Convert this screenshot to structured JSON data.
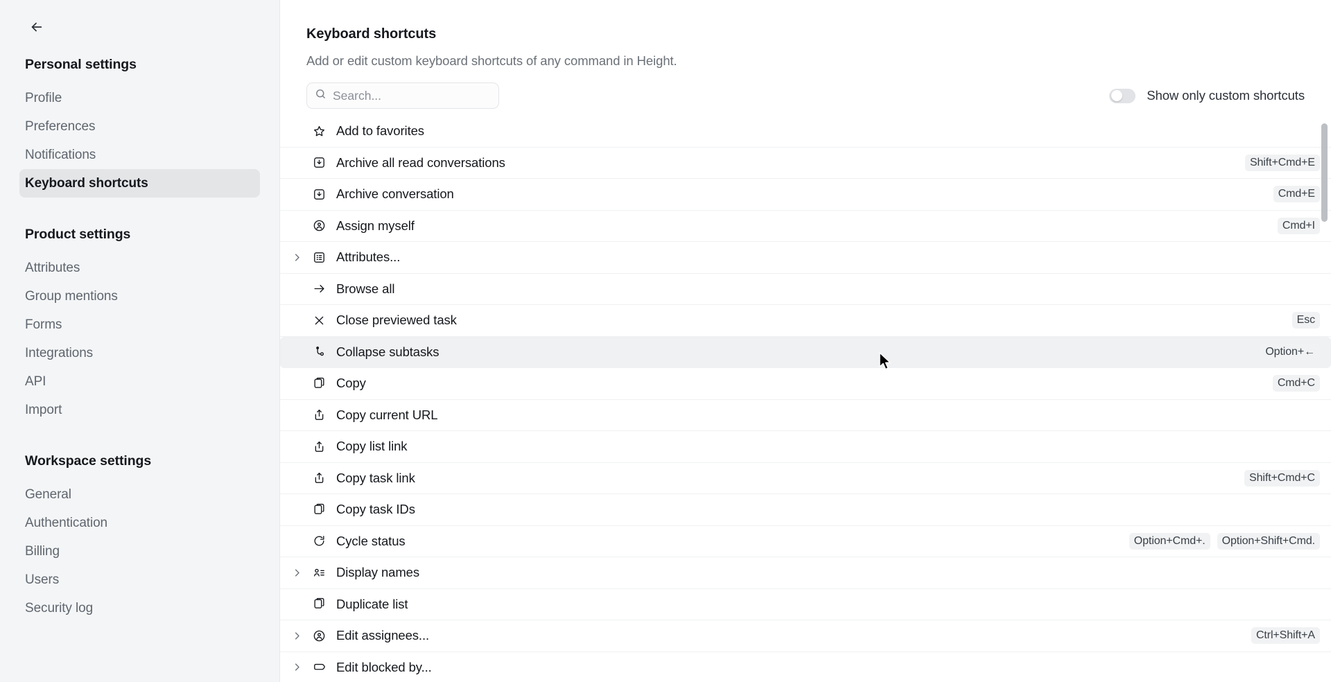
{
  "sidebar": {
    "back_icon": "arrow-left-icon",
    "groups": [
      {
        "title": "Personal settings",
        "items": [
          {
            "label": "Profile",
            "active": false
          },
          {
            "label": "Preferences",
            "active": false
          },
          {
            "label": "Notifications",
            "active": false
          },
          {
            "label": "Keyboard shortcuts",
            "active": true
          }
        ]
      },
      {
        "title": "Product settings",
        "items": [
          {
            "label": "Attributes",
            "active": false
          },
          {
            "label": "Group mentions",
            "active": false
          },
          {
            "label": "Forms",
            "active": false
          },
          {
            "label": "Integrations",
            "active": false
          },
          {
            "label": "API",
            "active": false
          },
          {
            "label": "Import",
            "active": false
          }
        ]
      },
      {
        "title": "Workspace settings",
        "items": [
          {
            "label": "General",
            "active": false
          },
          {
            "label": "Authentication",
            "active": false
          },
          {
            "label": "Billing",
            "active": false
          },
          {
            "label": "Users",
            "active": false
          },
          {
            "label": "Security log",
            "active": false
          }
        ]
      }
    ]
  },
  "main": {
    "title": "Keyboard shortcuts",
    "subtitle": "Add or edit custom keyboard shortcuts of any command in Height.",
    "search": {
      "value": "",
      "placeholder": "Search...",
      "icon": "search-icon"
    },
    "toggle": {
      "label": "Show only custom shortcuts",
      "on": false
    },
    "shortcuts": [
      {
        "label": "Add to favorites",
        "icon": "star-icon",
        "expandable": false,
        "keys": []
      },
      {
        "label": "Archive all read conversations",
        "icon": "archive-icon",
        "expandable": false,
        "keys": [
          "Shift+Cmd+E"
        ]
      },
      {
        "label": "Archive conversation",
        "icon": "archive-icon",
        "expandable": false,
        "keys": [
          "Cmd+E"
        ]
      },
      {
        "label": "Assign myself",
        "icon": "user-circle-icon",
        "expandable": false,
        "keys": [
          "Cmd+I"
        ]
      },
      {
        "label": "Attributes...",
        "icon": "attributes-icon",
        "expandable": true,
        "keys": []
      },
      {
        "label": "Browse all",
        "icon": "arrow-right-icon",
        "expandable": false,
        "keys": []
      },
      {
        "label": "Close previewed task",
        "icon": "close-icon",
        "expandable": false,
        "keys": [
          "Esc"
        ]
      },
      {
        "label": "Collapse subtasks",
        "icon": "subtask-icon",
        "expandable": false,
        "keys": [
          "Option+←"
        ],
        "highlight": true
      },
      {
        "label": "Copy",
        "icon": "copy-icon",
        "expandable": false,
        "keys": [
          "Cmd+C"
        ]
      },
      {
        "label": "Copy current URL",
        "icon": "share-icon",
        "expandable": false,
        "keys": []
      },
      {
        "label": "Copy list link",
        "icon": "share-icon",
        "expandable": false,
        "keys": []
      },
      {
        "label": "Copy task link",
        "icon": "share-icon",
        "expandable": false,
        "keys": [
          "Shift+Cmd+C"
        ]
      },
      {
        "label": "Copy task IDs",
        "icon": "copy-icon",
        "expandable": false,
        "keys": []
      },
      {
        "label": "Cycle status",
        "icon": "cycle-icon",
        "expandable": false,
        "keys": [
          "Option+Cmd+.",
          "Option+Shift+Cmd."
        ]
      },
      {
        "label": "Display names",
        "icon": "display-names-icon",
        "expandable": true,
        "keys": []
      },
      {
        "label": "Duplicate list",
        "icon": "copy-icon",
        "expandable": false,
        "keys": []
      },
      {
        "label": "Edit assignees...",
        "icon": "user-circle-icon",
        "expandable": true,
        "keys": [
          "Ctrl+Shift+A"
        ]
      },
      {
        "label": "Edit blocked by...",
        "icon": "tag-icon",
        "expandable": true,
        "keys": []
      }
    ]
  },
  "colors": {
    "sidebar_bg": "#f4f5f6",
    "active_item_bg": "#e4e5e7",
    "row_highlight_bg": "#f0f1f2",
    "key_chip_bg": "#f1f2f3",
    "text_primary": "#15181d",
    "text_muted": "#6b7178"
  }
}
